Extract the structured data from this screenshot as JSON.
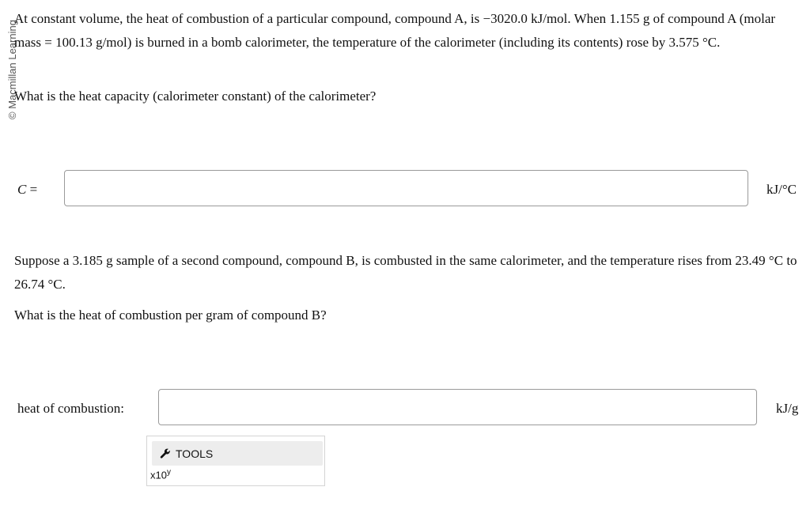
{
  "watermark": "© Macmillan Learning",
  "question1": {
    "text": "At constant volume, the heat of combustion of a particular compound, compound A, is −3020.0 kJ/mol. When 1.155 g of compound A (molar mass = 100.13 g/mol) is burned in a bomb calorimeter, the temperature of the calorimeter (including its contents) rose by 3.575 °C.",
    "prompt": "What is the heat capacity (calorimeter constant) of the calorimeter?",
    "label_var": "C",
    "label_eq": " =",
    "answer_value": "",
    "unit": "kJ/°C"
  },
  "question2": {
    "text": "Suppose a 3.185 g sample of a second compound, compound B, is combusted in the same calorimeter, and the temperature rises from 23.49 °C to 26.74 °C.",
    "prompt": "What is the heat of combustion per gram of compound B?",
    "label": "heat of combustion:",
    "answer_value": "",
    "unit": "kJ/g"
  },
  "tools": {
    "label": "TOOLS",
    "icon": "wrench-icon",
    "sci_base": "x10",
    "sci_exp": "y"
  }
}
